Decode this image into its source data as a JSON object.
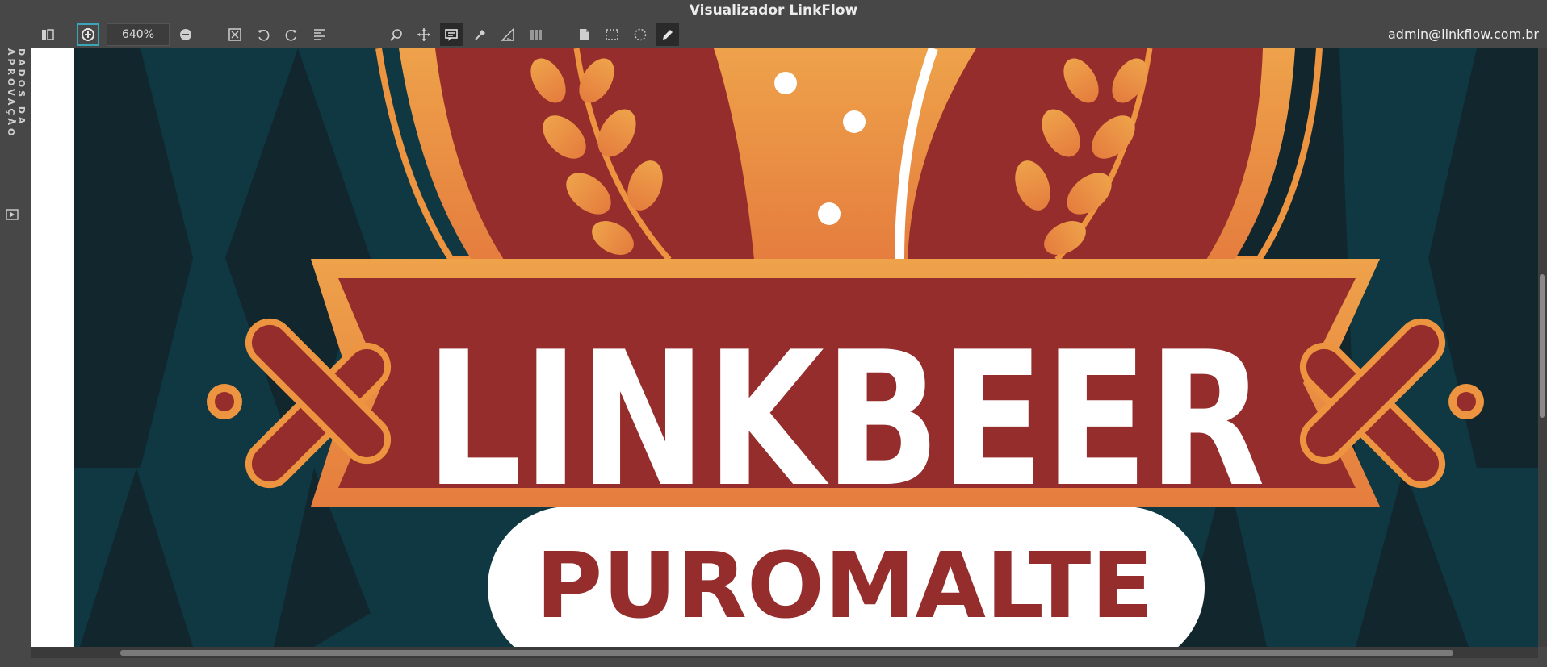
{
  "window": {
    "title": "Visualizador LinkFlow"
  },
  "user": {
    "email": "admin@linkflow.com.br"
  },
  "sidebar": {
    "label": "DADOS DA APROVAÇÃO"
  },
  "toolbar": {
    "zoom": "640%",
    "tools": [
      {
        "name": "toggle-panel-icon"
      },
      {
        "name": "zoom-in-icon"
      },
      {
        "name": "zoom-out-icon"
      },
      {
        "name": "fit-screen-icon"
      },
      {
        "name": "rotate-left-icon"
      },
      {
        "name": "rotate-right-icon"
      },
      {
        "name": "align-icon"
      },
      {
        "name": "search-icon"
      },
      {
        "name": "pan-icon"
      },
      {
        "name": "comment-icon"
      },
      {
        "name": "eyedropper-icon"
      },
      {
        "name": "measure-icon"
      },
      {
        "name": "barcode-icon"
      },
      {
        "name": "page-icon"
      },
      {
        "name": "rect-select-icon"
      },
      {
        "name": "lasso-select-icon"
      },
      {
        "name": "pencil-icon"
      }
    ]
  },
  "artwork": {
    "brand": "LINKBEER",
    "tagline": "PUROMALTE",
    "colors": {
      "background": "#0f3842",
      "red": "#952d2c",
      "orange": "#ec9440",
      "white": "#ffffff"
    }
  }
}
